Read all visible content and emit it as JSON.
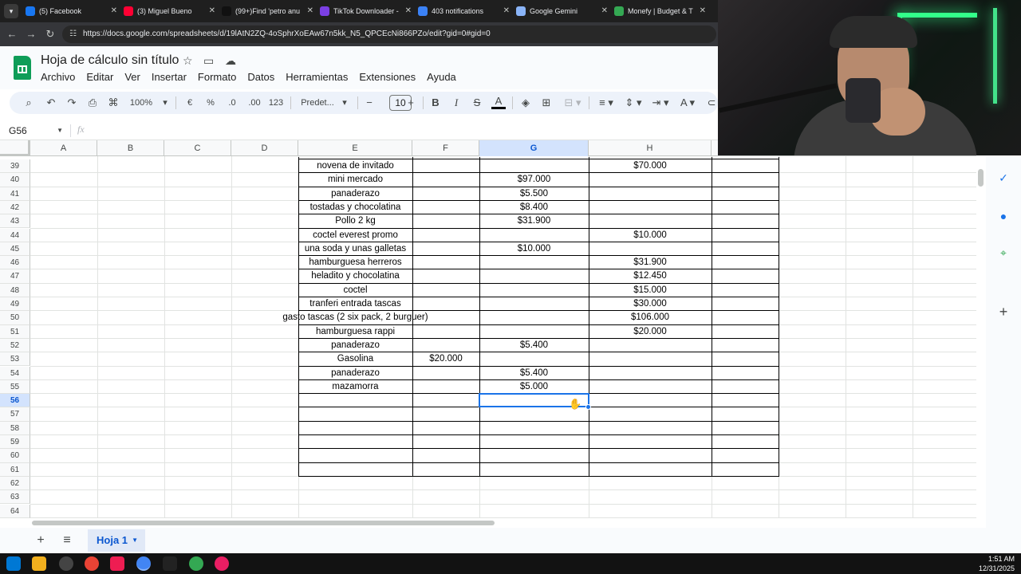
{
  "browser": {
    "tabs": [
      {
        "title": "(5) Facebook",
        "color": "#1877f2"
      },
      {
        "title": "(3) Miguel Bueno",
        "color": "#ff0033"
      },
      {
        "title": "(99+)Find 'petro anu",
        "color": "#111111"
      },
      {
        "title": "TikTok Downloader -",
        "color": "#7b3fe4"
      },
      {
        "title": "403 notifications",
        "color": "#3b82f6"
      },
      {
        "title": "Google Gemini",
        "color": "#8ab4f8"
      },
      {
        "title": "Monefy | Budget & T",
        "color": "#34a853"
      }
    ],
    "url": "https://docs.google.com/spreadsheets/d/19lAtN2ZQ-4oSphrXoEAw67n5kk_N5_QPCEcNi866PZo/edit?gid=0#gid=0"
  },
  "doc": {
    "title": "Hoja de cálculo sin título",
    "menus": [
      "Archivo",
      "Editar",
      "Ver",
      "Insertar",
      "Formato",
      "Datos",
      "Herramientas",
      "Extensiones",
      "Ayuda"
    ]
  },
  "toolbar": {
    "zoom": "100%",
    "currency": "€",
    "percent": "%",
    "dec_down": ".0",
    "dec_up": ".00",
    "number_format": "123",
    "font": "Predet...",
    "font_size": "10",
    "bold": "B",
    "italic": "I",
    "strike": "S",
    "text_color": "A"
  },
  "formula_bar": {
    "cell_ref": "G56",
    "fx": "fx"
  },
  "grid": {
    "columns": [
      "A",
      "B",
      "C",
      "D",
      "E",
      "F",
      "G",
      "H"
    ],
    "selected_column": "G",
    "row_numbers": [
      "39",
      "40",
      "41",
      "42",
      "43",
      "44",
      "45",
      "46",
      "47",
      "48",
      "49",
      "50",
      "51",
      "52",
      "53",
      "54",
      "55",
      "56",
      "57",
      "58",
      "59",
      "60",
      "61",
      "62",
      "63",
      "64"
    ],
    "selected_row": "56",
    "rows": [
      {
        "E": "novena de invitado",
        "F": "",
        "G": "",
        "H": "$70.000"
      },
      {
        "E": "mini mercado",
        "F": "",
        "G": "$97.000",
        "H": ""
      },
      {
        "E": "panaderazo",
        "F": "",
        "G": "$5.500",
        "H": ""
      },
      {
        "E": "tostadas y chocolatina",
        "F": "",
        "G": "$8.400",
        "H": ""
      },
      {
        "E": "Pollo 2 kg",
        "F": "",
        "G": "$31.900",
        "H": ""
      },
      {
        "E": "coctel everest promo",
        "F": "",
        "G": "",
        "H": "$10.000"
      },
      {
        "E": "una soda y unas galletas",
        "F": "",
        "G": "$10.000",
        "H": ""
      },
      {
        "E": "hamburguesa herreros",
        "F": "",
        "G": "",
        "H": "$31.900"
      },
      {
        "E": "heladito y chocolatina",
        "F": "",
        "G": "",
        "H": "$12.450"
      },
      {
        "E": "coctel",
        "F": "",
        "G": "",
        "H": "$15.000"
      },
      {
        "E": "tranferi entrada tascas",
        "F": "",
        "G": "",
        "H": "$30.000"
      },
      {
        "E": "gasto tascas (2 six pack, 2 burguer)",
        "F": "",
        "G": "",
        "H": "$106.000"
      },
      {
        "E": "hamburguesa rappi",
        "F": "",
        "G": "",
        "H": "$20.000"
      },
      {
        "E": "panaderazo",
        "F": "",
        "G": "$5.400",
        "H": ""
      },
      {
        "E": "Gasolina",
        "F": "$20.000",
        "G": "",
        "H": ""
      },
      {
        "E": "panaderazo",
        "F": "",
        "G": "$5.400",
        "H": ""
      },
      {
        "E": "mazamorra",
        "F": "",
        "G": "$5.000",
        "H": ""
      }
    ]
  },
  "sheets": {
    "active": "Hoja 1"
  },
  "taskbar": {
    "time": "1:51 AM",
    "date": "12/31/2025"
  },
  "colors": {
    "accent": "#1a73e8",
    "sheets_green": "#0f9d58",
    "selection_bg": "#d3e3fd"
  }
}
